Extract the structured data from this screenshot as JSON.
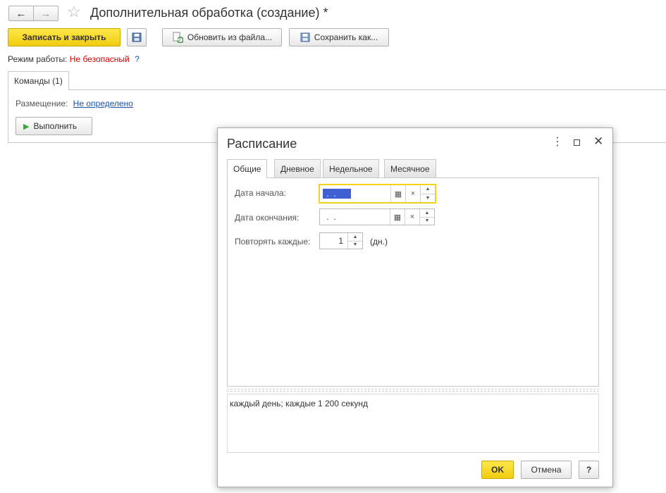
{
  "window": {
    "title": "Дополнительная обработка (создание) *"
  },
  "toolbar": {
    "save_close_label": "Записать и закрыть",
    "update_from_file_label": "Обновить из файла...",
    "save_as_label": "Сохранить как..."
  },
  "mode": {
    "label": "Режим работы:",
    "value": "Не безопасный",
    "help": "?"
  },
  "main_tabs": [
    {
      "label": "Команды (1)"
    }
  ],
  "placement": {
    "label": "Размещение:",
    "value": "Не определено"
  },
  "execute_label": "Выполнить",
  "dialog": {
    "title": "Расписание",
    "tabs": [
      {
        "label": "Общие"
      },
      {
        "label": "Дневное"
      },
      {
        "label": "Недельное"
      },
      {
        "label": "Месячное"
      }
    ],
    "start_date": {
      "label": "Дата начала:",
      "value": " .  . "
    },
    "end_date": {
      "label": "Дата окончания:",
      "value": " .  . "
    },
    "repeat": {
      "label": "Повторять каждые:",
      "value": "1",
      "unit": "(дн.)"
    },
    "summary": "каждый день; каждые 1 200 секунд",
    "ok_label": "OK",
    "cancel_label": "Отмена",
    "help_label": "?"
  },
  "colors": {
    "accent_yellow": "#f5d21a",
    "link_blue": "#1d54a8",
    "warning_red": "#d40000",
    "selection_blue": "#3f5fd2"
  }
}
